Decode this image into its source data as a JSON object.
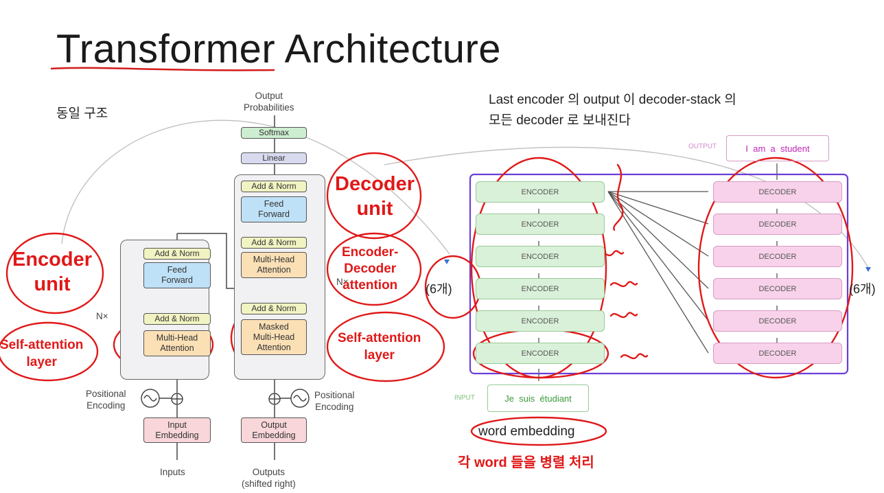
{
  "title": "Transformer Architecture",
  "left_note": "동일 구조",
  "right_note": {
    "line1": "Last encoder 의 output 이 decoder-stack 의",
    "line2": "모든 decoder 로 보내진다"
  },
  "encoder_side": {
    "add_norm_top": "Add & Norm",
    "feed_forward": "Feed\nForward",
    "add_norm_bottom": "Add & Norm",
    "attention": "Multi-Head\nAttention",
    "nx": "N×",
    "positional_encoding": "Positional\nEncoding",
    "input_embedding": "Input\nEmbedding",
    "inputs": "Inputs"
  },
  "decoder_side": {
    "output_probabilities": "Output\nProbabilities",
    "softmax": "Softmax",
    "linear": "Linear",
    "add_norm_top": "Add & Norm",
    "feed_forward": "Feed\nForward",
    "add_norm_mid": "Add & Norm",
    "cross_attention": "Multi-Head\nAttention",
    "add_norm_bottom": "Add & Norm",
    "masked_attention": "Masked\nMulti-Head\nAttention",
    "nx": "N×",
    "positional_encoding": "Positional\nEncoding",
    "output_embedding": "Output\nEmbedding",
    "outputs": "Outputs\n(shifted right)"
  },
  "annotations": {
    "encoder_unit": "Encoder\nunit",
    "self_attention_left": "Self-attention\nlayer",
    "decoder_unit": "Decoder\nunit",
    "encoder_decoder_attention": "Encoder-\nDecoder\nattention",
    "self_attention_right": "Self-attention\nlayer",
    "six_left": "(6개)",
    "six_right": "(6개)",
    "word_embedding": "word embedding",
    "parallel": "각 word 들을 병렬 처리"
  },
  "stack_diagram": {
    "output_label": "OUTPUT",
    "output_text": "I  am  a  student",
    "input_label": "INPUT",
    "input_text": "Je  suis  étudiant",
    "encoders": [
      "ENCODER",
      "ENCODER",
      "ENCODER",
      "ENCODER",
      "ENCODER",
      "ENCODER"
    ],
    "decoders": [
      "DECODER",
      "DECODER",
      "DECODER",
      "DECODER",
      "DECODER",
      "DECODER"
    ]
  },
  "colors": {
    "annotation_red": "#e01818",
    "stack_border": "#6a3fd6",
    "encoder_fill": "#daf1d9",
    "decoder_fill": "#f8d2ea",
    "output_text": "#c026b8"
  }
}
